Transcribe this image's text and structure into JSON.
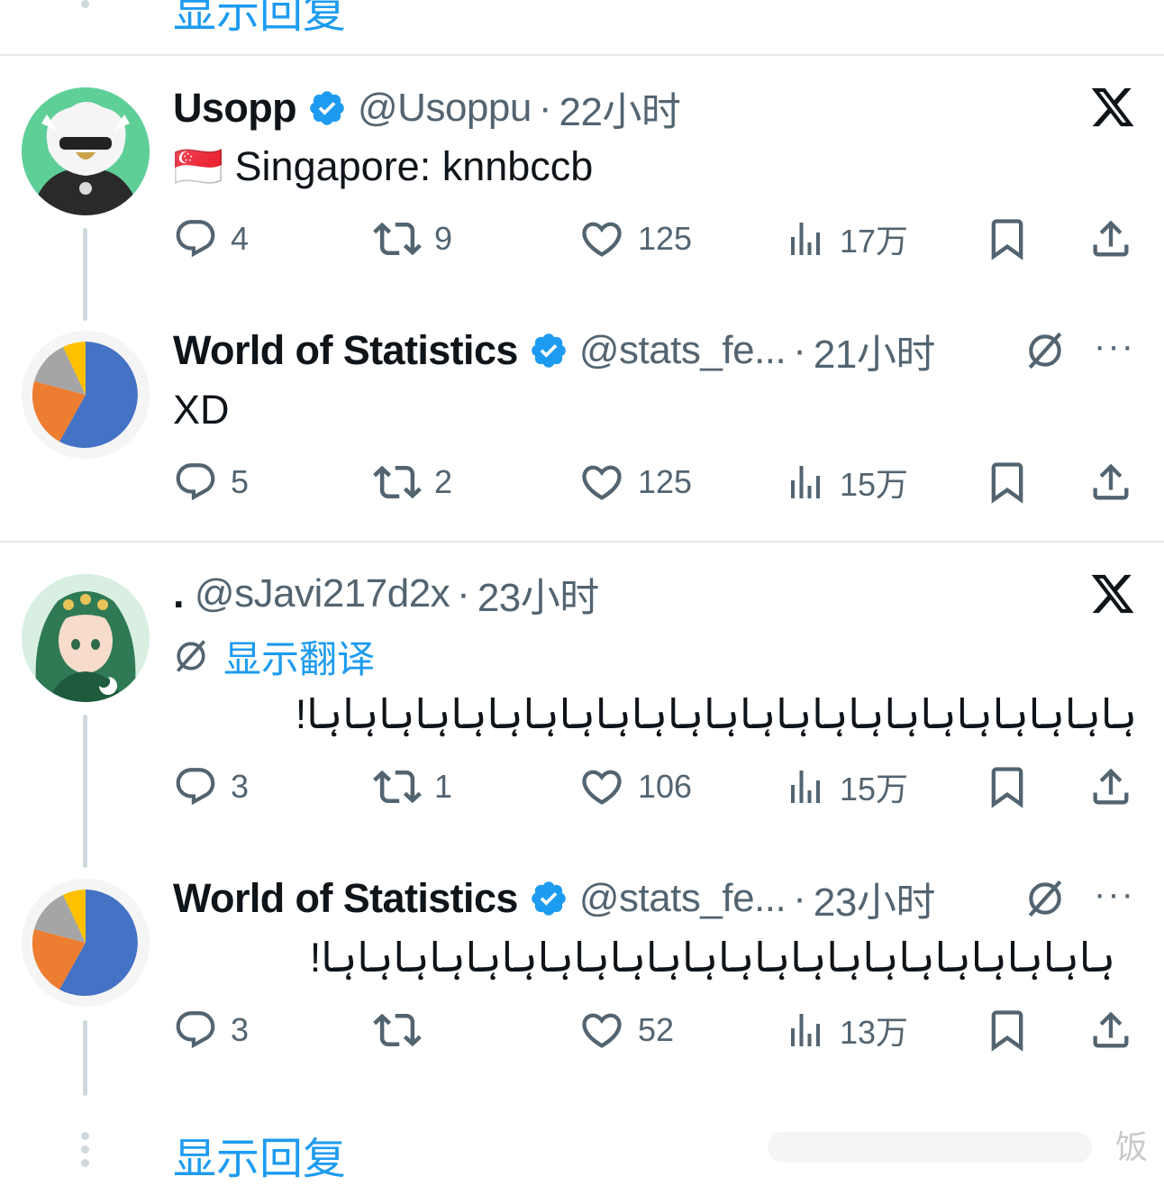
{
  "top": {
    "show_replies": "显示回复"
  },
  "tweets": [
    {
      "name": "Usopp",
      "handle": "@Usoppu",
      "time": "22小时",
      "flag": "🇸🇬",
      "text": "Singapore: knnbccb",
      "replies": "4",
      "retweets": "9",
      "likes": "125",
      "views": "17万"
    },
    {
      "name": "World of Statistics",
      "handle": "@stats_fe...",
      "time": "21小时",
      "text": "XD",
      "more": "···",
      "replies": "5",
      "retweets": "2",
      "likes": "125",
      "views": "15万"
    },
    {
      "name": ".",
      "handle": "@sJavi217d2x",
      "time": "23小时",
      "translate": "显示翻译",
      "text": "!ہاہاہاہاہاہاہاہاہاہاہاہاہاہاہاہاہاہاہاہاہاہاہا",
      "replies": "3",
      "retweets": "1",
      "likes": "106",
      "views": "15万"
    },
    {
      "name": "World of Statistics",
      "handle": "@stats_fe...",
      "time": "23小时",
      "text": "!ہاہاہاہاہاہاہاہاہاہاہاہاہاہاہاہاہاہاہاہاہاہا",
      "more": "···",
      "replies": "3",
      "retweets": "",
      "likes": "52",
      "views": "13万"
    }
  ],
  "bottom": {
    "show_replies": "显示回复"
  },
  "watermark": "饭",
  "colors": {
    "accent": "#1d9bf0",
    "muted": "#536471",
    "line": "#cfd9de"
  }
}
